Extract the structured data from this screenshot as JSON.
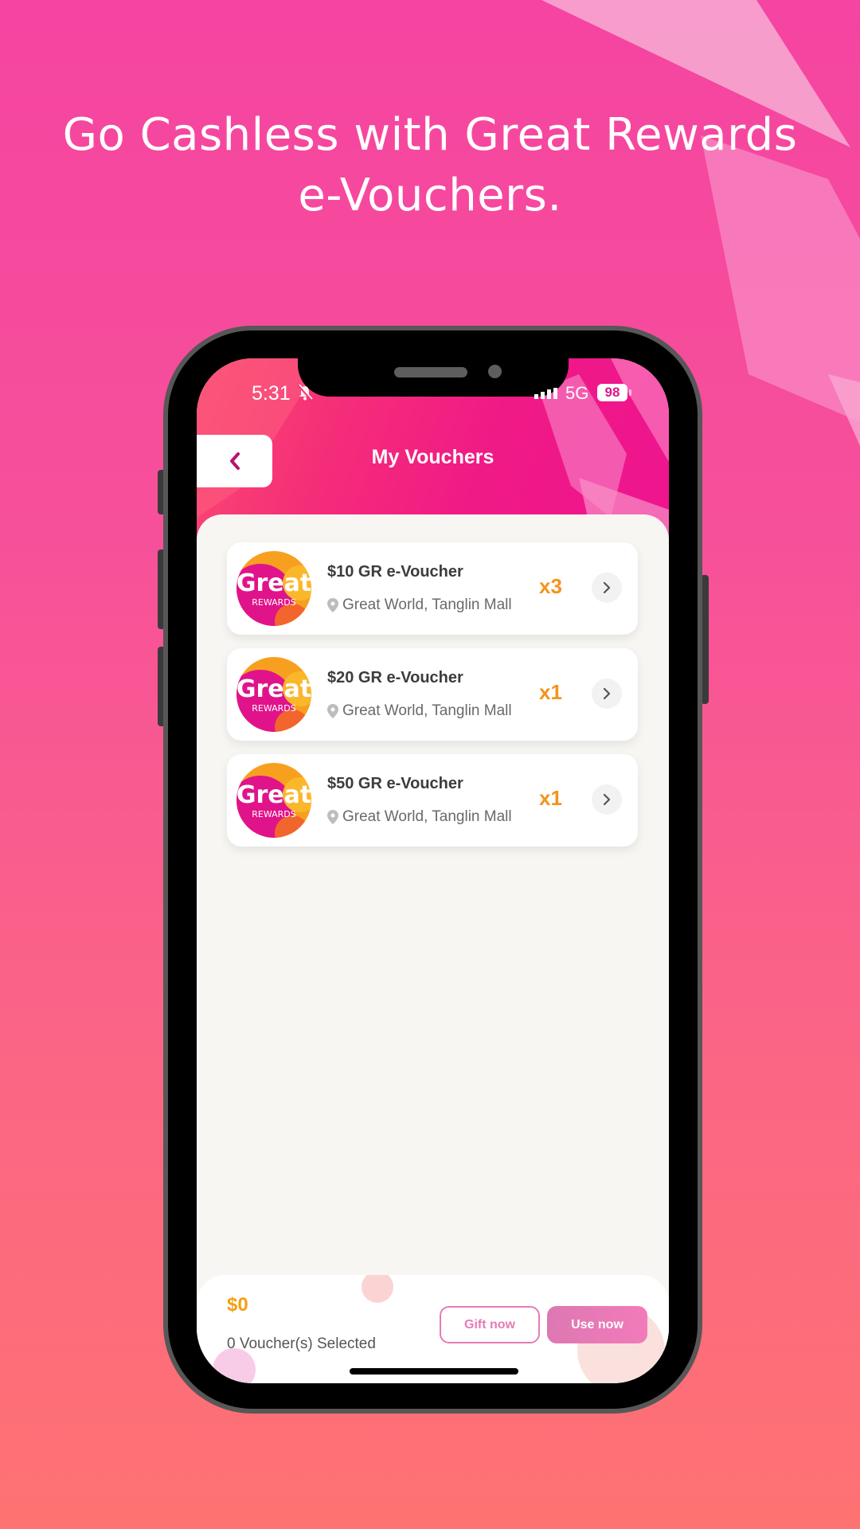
{
  "promo": {
    "headline_line1": "Go Cashless with Great Rewards",
    "headline_line2": "e-Vouchers."
  },
  "status_bar": {
    "time": "5:31",
    "network": "5G",
    "battery": "98"
  },
  "header": {
    "title": "My Vouchers",
    "back_icon": "chevron-left-icon"
  },
  "vouchers": [
    {
      "title": "$10 GR e-Voucher",
      "location": "Great World, Tanglin Mall",
      "quantity": "x3",
      "logo_text": "Great",
      "logo_sub": "REWARDS"
    },
    {
      "title": "$20 GR e-Voucher",
      "location": "Great World, Tanglin Mall",
      "quantity": "x1",
      "logo_text": "Great",
      "logo_sub": "REWARDS"
    },
    {
      "title": "$50 GR e-Voucher",
      "location": "Great World, Tanglin Mall",
      "quantity": "x1",
      "logo_text": "Great",
      "logo_sub": "REWARDS"
    }
  ],
  "footer": {
    "total": "$0",
    "selected_label": "0 Voucher(s) Selected",
    "gift_label": "Gift now",
    "use_label": "Use now"
  },
  "colors": {
    "brand_pink": "#ee148f",
    "accent_orange": "#f3941c",
    "button_pink": "#e77bb6"
  }
}
